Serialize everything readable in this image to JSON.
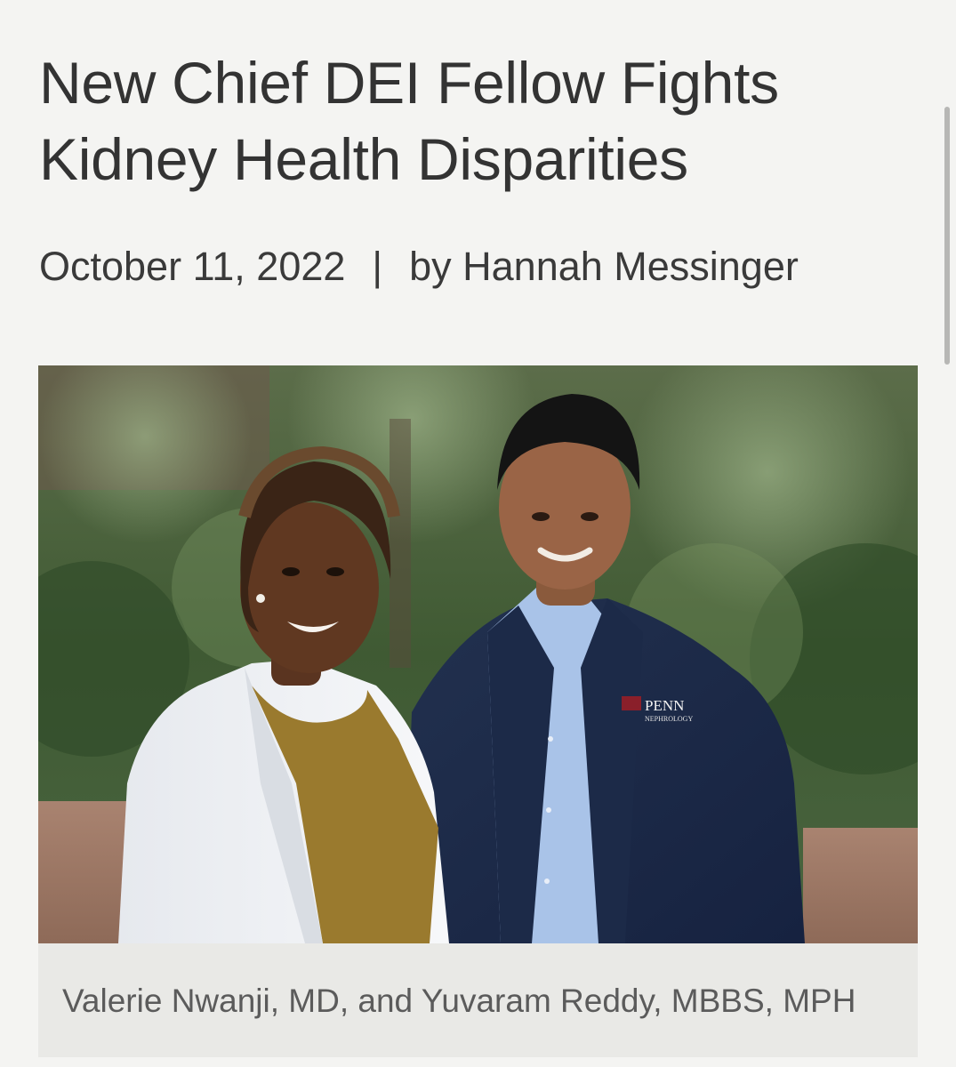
{
  "article": {
    "title": "New Chief DEI Fellow Fights Kidney Health Disparities",
    "date": "October 11, 2022",
    "separator": "|",
    "byline": "by Hannah Messinger"
  },
  "photo": {
    "jacket_logo_text": "PENN",
    "jacket_logo_subtext": "NEPHROLOGY",
    "caption": "Valerie Nwanji, MD, and Yuvaram Reddy, MBBS, MPH"
  },
  "colors": {
    "page_background": "#f4f4f2",
    "caption_background": "#e9e9e6",
    "title_text": "#333333",
    "caption_text": "#5b5b5b"
  }
}
